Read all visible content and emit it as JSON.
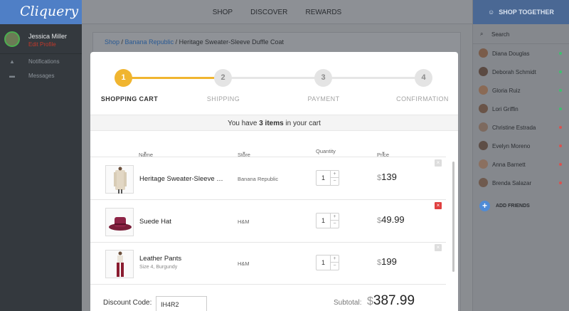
{
  "app": {
    "logo": "Cliquery"
  },
  "user": {
    "name": "Jessica Miller",
    "edit_label": "Edit Profile"
  },
  "left_nav": [
    {
      "label": "Notifications",
      "icon": "bell-icon"
    },
    {
      "label": "Messages",
      "icon": "envelope-icon"
    }
  ],
  "top_nav": [
    "SHOP",
    "DISCOVER",
    "REWARDS"
  ],
  "right_panel": {
    "title": "SHOP TOGETHER",
    "search_label": "Search",
    "add_friends_label": "ADD FRIENDS",
    "friends": [
      {
        "name": "Diana Douglas",
        "status": "online"
      },
      {
        "name": "Deborah Schmidt",
        "status": "online"
      },
      {
        "name": "Gloria Ruiz",
        "status": "online"
      },
      {
        "name": "Lori Griffin",
        "status": "online"
      },
      {
        "name": "Christine Estrada",
        "status": "offline"
      },
      {
        "name": "Evelyn Moreno",
        "status": "offline"
      },
      {
        "name": "Anna Barnett",
        "status": "offline"
      },
      {
        "name": "Brenda Salazar",
        "status": "offline"
      }
    ]
  },
  "breadcrumb": {
    "shop": "Shop",
    "sep1": " / ",
    "brand": "Banana Republic",
    "sep2": " / ",
    "product": "Heritage Sweater-Sleeve Duffle Coat"
  },
  "checkout": {
    "steps": [
      {
        "num": "1",
        "label": "SHOPPING CART"
      },
      {
        "num": "2",
        "label": "SHIPPING"
      },
      {
        "num": "3",
        "label": "PAYMENT"
      },
      {
        "num": "4",
        "label": "CONFIRMATION"
      }
    ],
    "active_step": 1,
    "notice_pre": "You have ",
    "notice_count": "3 items",
    "notice_post": " in your cart",
    "columns": {
      "name": "Name",
      "store": "Store",
      "quantity": "Quantity",
      "price": "Price"
    },
    "items": [
      {
        "name": "Heritage Sweater-Sleeve Duffle Coat",
        "desc": "",
        "store": "Banana Republic",
        "qty": "1",
        "currency": "$",
        "price": "139"
      },
      {
        "name": "Suede Hat",
        "desc": "",
        "store": "H&M",
        "qty": "1",
        "currency": "$",
        "price": "49.99"
      },
      {
        "name": "Leather Pants",
        "desc": "Size 4, Burgundy",
        "store": "H&M",
        "qty": "1",
        "currency": "$",
        "price": "199"
      }
    ],
    "discount_label": "Discount Code:",
    "discount_code": "IH4R2",
    "subtotal_label": "Subtotal:",
    "subtotal_currency": "$",
    "subtotal": "387.99"
  },
  "colors": {
    "accent": "#f0b530",
    "brand_blue": "#4f7fc6",
    "online": "#3fbf6f",
    "offline": "#d9534f",
    "remove_active": "#e04040"
  }
}
